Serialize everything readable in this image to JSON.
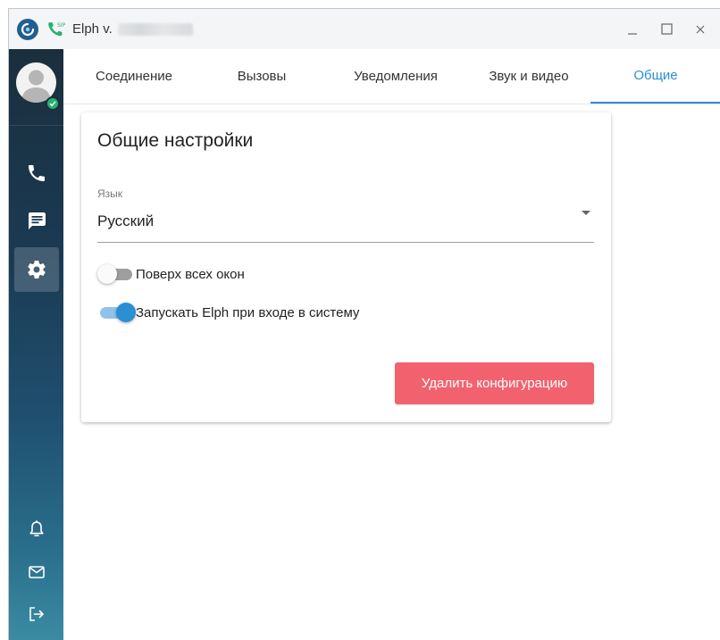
{
  "window": {
    "app_name": "Elph v."
  },
  "colors": {
    "accent": "#2b8fd3",
    "danger": "#f2626e",
    "online": "#27b06e",
    "sidebar_top": "#1a2f3e",
    "sidebar_bottom": "#3a8ba3"
  },
  "sidebar": {
    "status": "online",
    "top_items": [
      {
        "icon": "phone-icon"
      },
      {
        "icon": "chat-icon"
      },
      {
        "icon": "gear-icon",
        "active": true
      }
    ],
    "bottom_items": [
      {
        "icon": "bell-icon"
      },
      {
        "icon": "mail-icon"
      },
      {
        "icon": "logout-icon"
      }
    ]
  },
  "tabs": [
    {
      "label": "Соединение"
    },
    {
      "label": "Вызовы"
    },
    {
      "label": "Уведомления"
    },
    {
      "label": "Звук и видео"
    },
    {
      "label": "Общие",
      "active": true
    }
  ],
  "settings": {
    "title": "Общие настройки",
    "language_label": "Язык",
    "language_value": "Русский",
    "always_on_top_label": "Поверх всех окон",
    "always_on_top": false,
    "autostart_label": "Запускать Elph при входе в систему",
    "autostart": true,
    "delete_button": "Удалить конфигурацию"
  }
}
